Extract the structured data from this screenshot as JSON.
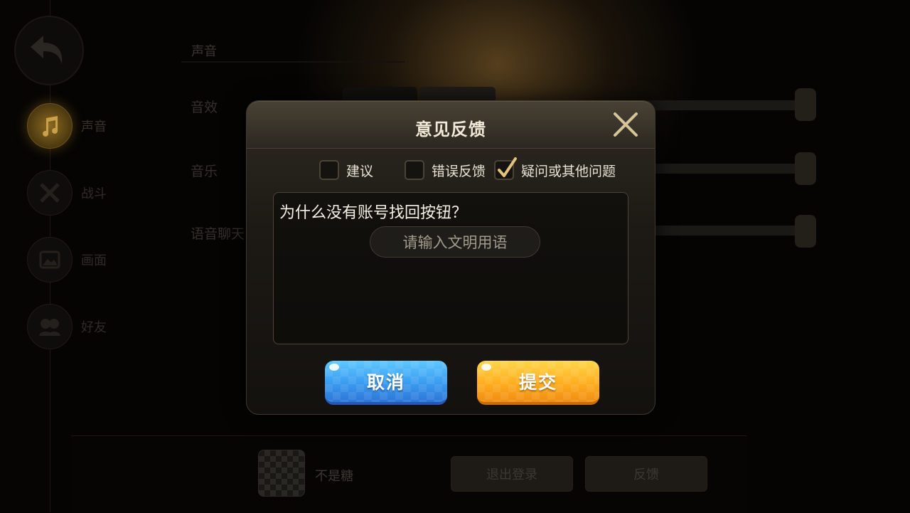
{
  "settings": {
    "section_title": "声音",
    "nav": [
      {
        "label": "声音",
        "icon": "music-note-icon",
        "active": true
      },
      {
        "label": "战斗",
        "icon": "crossed-swords-icon",
        "active": false
      },
      {
        "label": "画面",
        "icon": "image-icon",
        "active": false
      },
      {
        "label": "好友",
        "icon": "friends-icon",
        "active": false
      }
    ],
    "rows": [
      {
        "label": "音效"
      },
      {
        "label": "音乐"
      },
      {
        "label": "语音聊天"
      }
    ],
    "profile": {
      "name": "不是糖"
    },
    "logout_label": "退出登录",
    "feedback_label": "反馈"
  },
  "dialog": {
    "title": "意见反馈",
    "options": [
      {
        "label": "建议",
        "checked": false
      },
      {
        "label": "错误反馈",
        "checked": false
      },
      {
        "label": "疑问或其他问题",
        "checked": true
      }
    ],
    "input_text": "为什么没有账号找回按钮？",
    "input_hint": "请输入文明用语",
    "cancel_label": "取消",
    "submit_label": "提交"
  },
  "colors": {
    "cancel": "#3a9bf0",
    "submit": "#ffad1f",
    "check_accent": "#e3c27a"
  }
}
